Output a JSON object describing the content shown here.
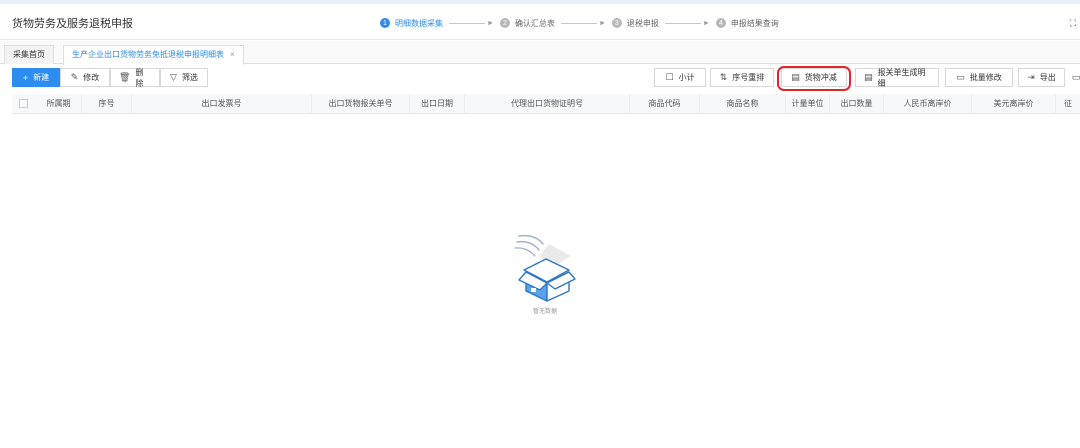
{
  "header": {
    "app_title": "货物劳务及服务退税申报",
    "steps": [
      {
        "num": "1",
        "label": "明细数据采集"
      },
      {
        "num": "2",
        "label": "确认汇总表"
      },
      {
        "num": "3",
        "label": "退税申报"
      },
      {
        "num": "4",
        "label": "申报结果查询"
      }
    ]
  },
  "tabs": [
    {
      "label": "采集首页"
    },
    {
      "label": "生产企业出口货物劳务免抵退税申报明细表",
      "close": "×"
    }
  ],
  "toolbar": {
    "new": "新建",
    "edit": "修改",
    "delete": "删除",
    "filter": "筛选",
    "subtotal": "小计",
    "reorder": "序号重排",
    "offset": "货物冲减",
    "generate": "报关单生成明细",
    "batch_edit": "批量修改",
    "export": "导出"
  },
  "table": {
    "columns": [
      "所属期",
      "序号",
      "出口发票号",
      "出口货物报关单号",
      "出口日期",
      "代理出口货物证明号",
      "商品代码",
      "商品名称",
      "计量单位",
      "出口数量",
      "人民币离岸价",
      "美元离岸价",
      "征"
    ]
  },
  "empty_state": {
    "text": "暂无数据"
  },
  "colors": {
    "accent": "#2d8cf0",
    "highlight": "#e0262a"
  }
}
